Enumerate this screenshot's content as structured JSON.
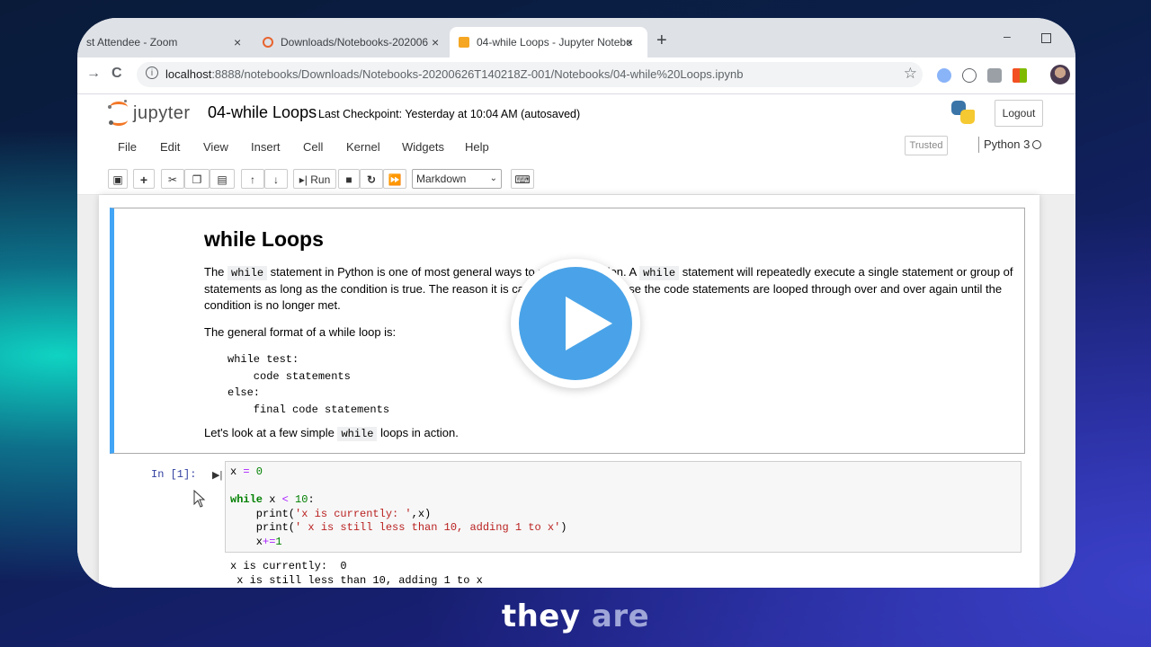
{
  "browser": {
    "tabs": [
      {
        "title": "st Attendee - Zoom",
        "close": "×"
      },
      {
        "title": "Downloads/Notebooks-20200626",
        "close": "×"
      },
      {
        "title": "04-while Loops - Jupyter Notebo",
        "close": "×"
      }
    ],
    "new_tab": "+",
    "window_min": "–",
    "back": "→",
    "reload": "C",
    "url_host": "localhost",
    "url_rest": ":8888/notebooks/Downloads/Notebooks-20200626T140218Z-001/Notebooks/04-while%20Loops.ipynb",
    "bookmark_star": "☆",
    "info": "i"
  },
  "jupyter": {
    "brand": "jupyter",
    "notebook_name": "04-while Loops",
    "checkpoint": "Last Checkpoint: Yesterday at 10:04 AM  (autosaved)",
    "logout": "Logout",
    "menu": [
      "File",
      "Edit",
      "View",
      "Insert",
      "Cell",
      "Kernel",
      "Widgets",
      "Help"
    ],
    "trusted": "Trusted",
    "kernel": "Python 3",
    "toolbar": {
      "run": "Run",
      "cell_type": "Markdown"
    }
  },
  "markdown_cell": {
    "heading": "while Loops",
    "p1_a": "The ",
    "p1_code1": "while",
    "p1_b": " statement in Python is one of most general ways to perform iteration. A ",
    "p1_code2": "while",
    "p1_c": " statement will repeatedly execute a single statement or group of statements as long as the condition is true. The reason it is called a 'loop' is because the code statements are looped through over and over again until the condition is no longer met.",
    "p2": "The general format of a while loop is:",
    "format_code": "while test:\n    code statements\nelse:\n    final code statements",
    "p3_a": "Let's look at a few simple ",
    "p3_code": "while",
    "p3_b": " loops in action."
  },
  "code_cell": {
    "prompt": "In [1]:",
    "run_marker": "▶|",
    "lines": {
      "l1_var": "x ",
      "l1_op": "=",
      "l1_num": " 0",
      "l3_kw": "while",
      "l3_mid": " x ",
      "l3_op": "<",
      "l3_num": " 10",
      "l3_end": ":",
      "l4_pre": "    print(",
      "l4_str": "'x is currently: '",
      "l4_end": ",x)",
      "l5_pre": "    print(",
      "l5_str": "' x is still less than 10, adding 1 to x'",
      "l5_end": ")",
      "l6_pre": "    x",
      "l6_op": "+=",
      "l6_num": "1"
    },
    "output": "x is currently:  0\n x is still less than 10, adding 1 to x"
  },
  "overlay": {
    "caption_a": "they ",
    "caption_b": "are"
  },
  "colors": {
    "jupyter_orange": "#f37726",
    "cell_selected_blue": "#42a5f5",
    "play_blue": "#4aa3e8"
  }
}
